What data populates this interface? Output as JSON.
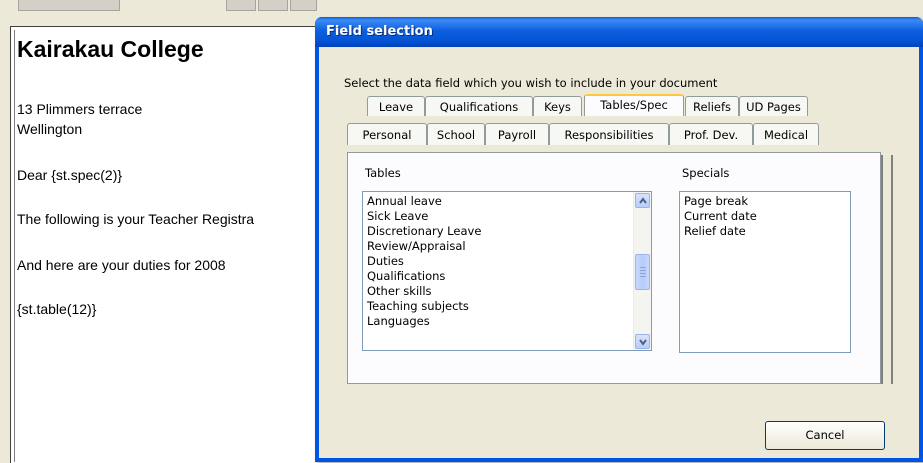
{
  "document": {
    "title": "Kairakau College",
    "lines": [
      "13 Plimmers terrace",
      "Wellington",
      "Dear {st.spec(2)}",
      "The following is your Teacher Registra",
      "And here are your duties for 2008",
      "{st.table(12)}"
    ]
  },
  "dialog": {
    "title": "Field selection",
    "instruction": "Select the data field which you wish to include in your document",
    "tabs_row1": [
      "Leave",
      "Qualifications",
      "Keys",
      "Tables/Spec",
      "Reliefs",
      "UD Pages"
    ],
    "tabs_row2": [
      "Personal",
      "School",
      "Payroll",
      "Responsibilities",
      "Prof. Dev.",
      "Medical"
    ],
    "selected_tab": "Tables/Spec",
    "tables_label": "Tables",
    "tables_items": [
      "Annual leave",
      "Sick Leave",
      "Discretionary Leave",
      "Review/Appraisal",
      "Duties",
      "Qualifications",
      "Other skills",
      "Teaching subjects",
      "Languages"
    ],
    "specials_label": "Specials",
    "specials_items": [
      "Page break",
      "Current date",
      "Relief date"
    ],
    "cancel_label": "Cancel"
  },
  "colors": {
    "titlebar": "#0054e3",
    "selected_tab_accent": "#ffc83c"
  }
}
